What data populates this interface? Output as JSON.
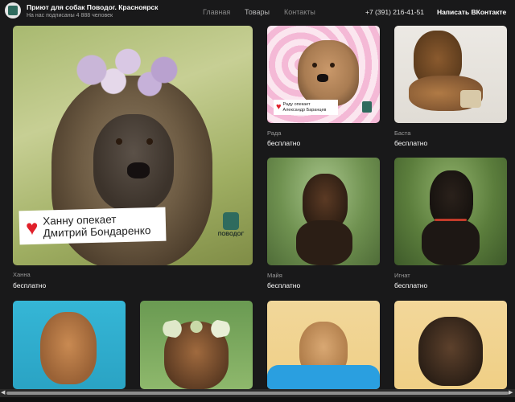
{
  "header": {
    "title": "Приют для собак Поводог. Красноярск",
    "subscribers": "На нас подписаны 4 888 человек",
    "nav": [
      "Главная",
      "Товары",
      "Контакты"
    ],
    "phone": "+7 (391) 216-41-51",
    "write_label": "Написать ВКонтакте"
  },
  "products": [
    {
      "name": "Ханна",
      "price": "бесплатно",
      "badge": "Ханну опекает\nДмитрий Бондаренко",
      "logo_text": "ПОВОДОГ"
    },
    {
      "name": "Рада",
      "price": "бесплатно",
      "badge": "Раду опекает\nАлександр Баранцев"
    },
    {
      "name": "Баста",
      "price": "бесплатно"
    },
    {
      "name": "Майя",
      "price": "бесплатно"
    },
    {
      "name": "Игнат",
      "price": "бесплатно"
    },
    {
      "name": "",
      "price": ""
    },
    {
      "name": "",
      "price": ""
    },
    {
      "name": "",
      "price": ""
    },
    {
      "name": "",
      "price": ""
    }
  ],
  "colors": {
    "background": "#19191a",
    "heart": "#e0202a"
  }
}
